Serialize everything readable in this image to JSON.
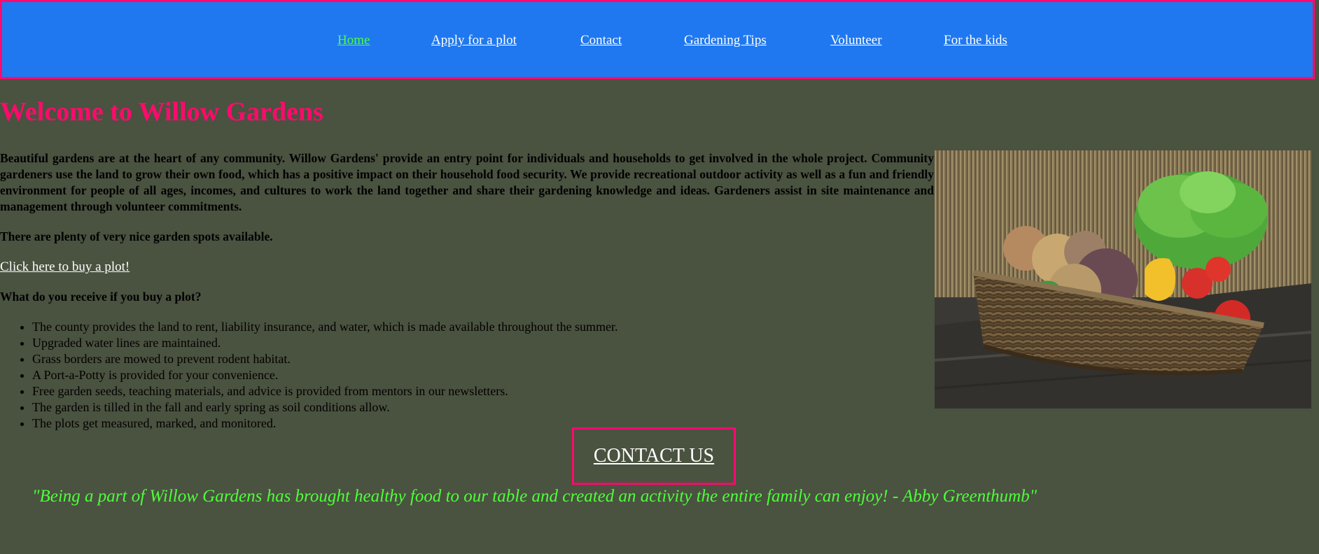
{
  "nav": {
    "items": [
      {
        "label": "Home",
        "active": true
      },
      {
        "label": "Apply for a plot",
        "active": false
      },
      {
        "label": "Contact",
        "active": false
      },
      {
        "label": "Gardening Tips",
        "active": false
      },
      {
        "label": "Volunteer",
        "active": false
      },
      {
        "label": "For the kids",
        "active": false
      }
    ]
  },
  "main": {
    "title": "Welcome to Willow Gardens",
    "intro": "Beautiful gardens are at the heart of any community. Willow Gardens' provide an entry point for individuals and households to get involved in the whole project. Community gardeners use the land to grow their own food, which has a positive impact on their household food security. We provide recreational outdoor activity as well as a fun and friendly environment for people of all ages, incomes, and cultures to work the land together and share their gardening knowledge and ideas. Gardeners assist in site maintenance and management through volunteer commitments.",
    "availability": "There are plenty of very nice garden spots available.",
    "buy_link": "Click here to buy a plot!",
    "receive_heading": "What do you receive if you buy a plot?",
    "benefits": [
      "The county provides the land to rent, liability insurance, and water, which is made available throughout the summer.",
      "Upgraded water lines are maintained.",
      "Grass borders are mowed to prevent rodent habitat.",
      "A Port-a-Potty is provided for your convenience.",
      "Free garden seeds, teaching materials, and advice is provided from mentors in our newsletters.",
      "The garden is tilled in the fall and early spring as soil conditions allow.",
      "The plots get measured, marked, and monitored."
    ],
    "contact_button": "CONTACT US",
    "quote": "\"Being a part of Willow Gardens has brought healthy food to our table and created an activity the entire family can enjoy! - Abby Greenthumb\""
  },
  "colors": {
    "background": "#4a5240",
    "nav_background": "#1f78f0",
    "accent_pink": "#ff0a6c",
    "accent_green": "#4dff3a",
    "link_white": "#ffffff"
  }
}
